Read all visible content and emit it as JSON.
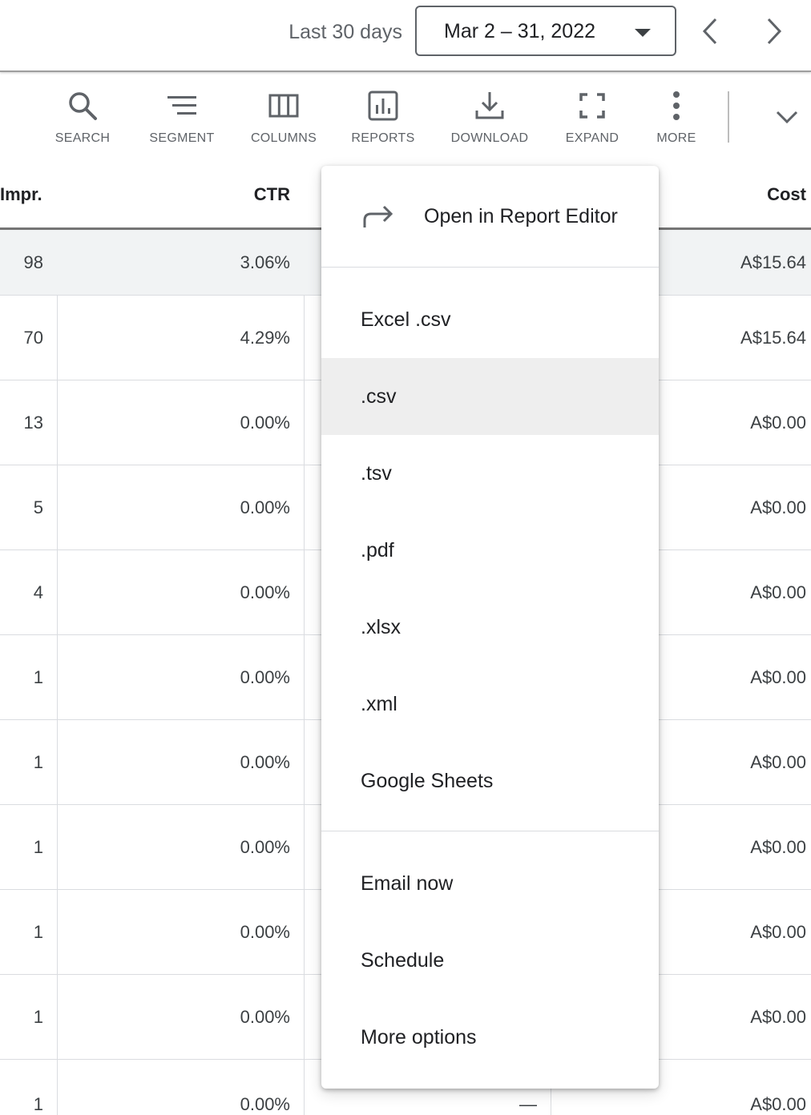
{
  "date_bar": {
    "range_label": "Last 30 days",
    "date_range": "Mar 2 – 31, 2022"
  },
  "toolbar": {
    "items": [
      {
        "label": "SEARCH",
        "icon": "search-icon"
      },
      {
        "label": "SEGMENT",
        "icon": "segment-icon"
      },
      {
        "label": "COLUMNS",
        "icon": "columns-icon"
      },
      {
        "label": "REPORTS",
        "icon": "reports-icon"
      },
      {
        "label": "DOWNLOAD",
        "icon": "download-icon"
      },
      {
        "label": "EXPAND",
        "icon": "expand-icon"
      },
      {
        "label": "MORE",
        "icon": "more-vert-icon"
      }
    ]
  },
  "table": {
    "headers": {
      "impr": "Impr.",
      "ctr": "CTR",
      "cost": "Cost"
    },
    "rows": [
      {
        "impr": "98",
        "ctr": "3.06%",
        "mid": "",
        "cost": "A$15.64"
      },
      {
        "impr": "70",
        "ctr": "4.29%",
        "mid": "",
        "cost": "A$15.64"
      },
      {
        "impr": "13",
        "ctr": "0.00%",
        "mid": "",
        "cost": "A$0.00"
      },
      {
        "impr": "5",
        "ctr": "0.00%",
        "mid": "",
        "cost": "A$0.00"
      },
      {
        "impr": "4",
        "ctr": "0.00%",
        "mid": "",
        "cost": "A$0.00"
      },
      {
        "impr": "1",
        "ctr": "0.00%",
        "mid": "",
        "cost": "A$0.00"
      },
      {
        "impr": "1",
        "ctr": "0.00%",
        "mid": "",
        "cost": "A$0.00"
      },
      {
        "impr": "1",
        "ctr": "0.00%",
        "mid": "",
        "cost": "A$0.00"
      },
      {
        "impr": "1",
        "ctr": "0.00%",
        "mid": "",
        "cost": "A$0.00"
      },
      {
        "impr": "1",
        "ctr": "0.00%",
        "mid": "",
        "cost": "A$0.00"
      },
      {
        "impr": "1",
        "ctr": "0.00%",
        "mid": "—",
        "cost": "A$0.00"
      }
    ]
  },
  "download_menu": {
    "open_in_editor": "Open in Report Editor",
    "formats": [
      "Excel .csv",
      ".csv",
      ".tsv",
      ".pdf",
      ".xlsx",
      ".xml",
      "Google Sheets"
    ],
    "actions": [
      "Email now",
      "Schedule",
      "More options"
    ]
  }
}
